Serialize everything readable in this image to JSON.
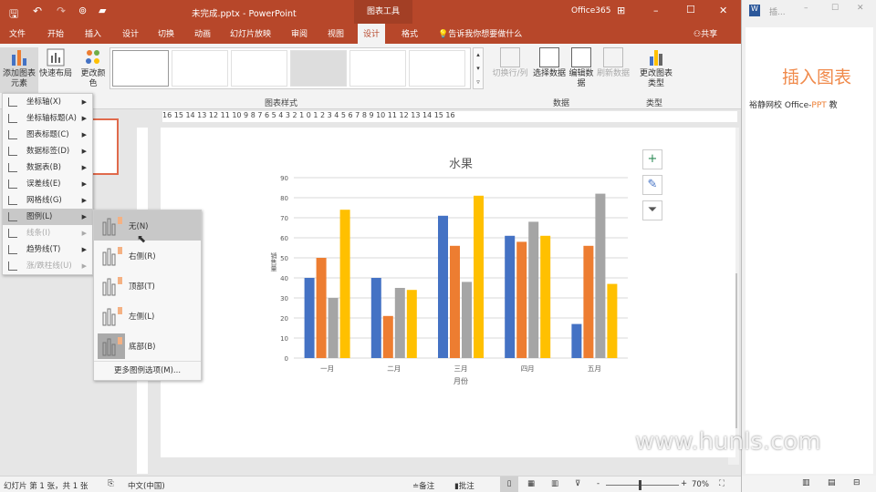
{
  "titlebar": {
    "filename": "未完成.pptx",
    "sep": "-",
    "app": "PowerPoint",
    "context_tab": "图表工具",
    "account": "Office365",
    "minimize": "–",
    "maximize": "☐",
    "close": "✕"
  },
  "tabs": [
    "文件",
    "开始",
    "插入",
    "设计",
    "切换",
    "动画",
    "幻灯片放映",
    "审阅",
    "视图",
    "设计",
    "格式"
  ],
  "tell_me": "告诉我你想要做什么",
  "share": "共享",
  "ribbon": {
    "add_element": "添加图表元素",
    "quick_layout": "快速布局",
    "change_color": "更改颜色",
    "chart_styles_label": "图表样式",
    "switch_row_col": "切换行/列",
    "select_data": "选择数据",
    "edit_data": "编辑数据",
    "refresh_data": "刷新数据",
    "data_label": "数据",
    "change_type": "更改图表类型",
    "type_label": "类型"
  },
  "menu": {
    "items": [
      {
        "label": "坐标轴(X)",
        "disabled": false
      },
      {
        "label": "坐标轴标题(A)",
        "disabled": false
      },
      {
        "label": "图表标题(C)",
        "disabled": false
      },
      {
        "label": "数据标签(D)",
        "disabled": false
      },
      {
        "label": "数据表(B)",
        "disabled": false
      },
      {
        "label": "误差线(E)",
        "disabled": false
      },
      {
        "label": "网格线(G)",
        "disabled": false
      },
      {
        "label": "图例(L)",
        "disabled": false
      },
      {
        "label": "线条(I)",
        "disabled": true
      },
      {
        "label": "趋势线(T)",
        "disabled": false
      },
      {
        "label": "涨/跌柱线(U)",
        "disabled": true
      }
    ]
  },
  "submenu": {
    "items": [
      "无(N)",
      "右侧(R)",
      "顶部(T)",
      "左侧(L)",
      "底部(B)"
    ],
    "more": "更多图例选项(M)..."
  },
  "ruler": "16 15 14 13 12 11 10 9 8 7 6 5 4 3 2 1 0 1 2 3 4 5 6 7 8 9 10 11 12 13 14 15 16",
  "chart_data": {
    "type": "bar",
    "title": "水果",
    "xlabel": "月份",
    "ylabel": "销售量",
    "categories": [
      "一月",
      "二月",
      "三月",
      "四月",
      "五月"
    ],
    "ylim": [
      0,
      90
    ],
    "yticks": [
      "0",
      "10",
      "20",
      "30",
      "40",
      "50",
      "60",
      "70",
      "80",
      "90"
    ],
    "grid": true,
    "legend": "none",
    "series": [
      {
        "color": "#4472c4",
        "values": [
          40,
          40,
          71,
          61,
          17
        ]
      },
      {
        "color": "#ed7d31",
        "values": [
          50,
          21,
          56,
          58,
          56
        ]
      },
      {
        "color": "#a5a5a5",
        "values": [
          30,
          35,
          38,
          68,
          82
        ]
      },
      {
        "color": "#ffc000",
        "values": [
          74,
          34,
          81,
          61,
          37
        ]
      }
    ]
  },
  "status": {
    "slide": "幻灯片 第 1 张，共 1 张",
    "lang": "中文(中国)",
    "notes": "备注",
    "comments": "批注",
    "zoom": "70%",
    "zoom_minus": "-",
    "zoom_plus": "+"
  },
  "right": {
    "title": "插...",
    "heading": "插入图表",
    "sub1": "裕静网校 Office-",
    "sub2": "PPT",
    "sub3": " 教"
  },
  "watermark": "www.hunls.com",
  "colors": {
    "accent": "#b7472a"
  }
}
